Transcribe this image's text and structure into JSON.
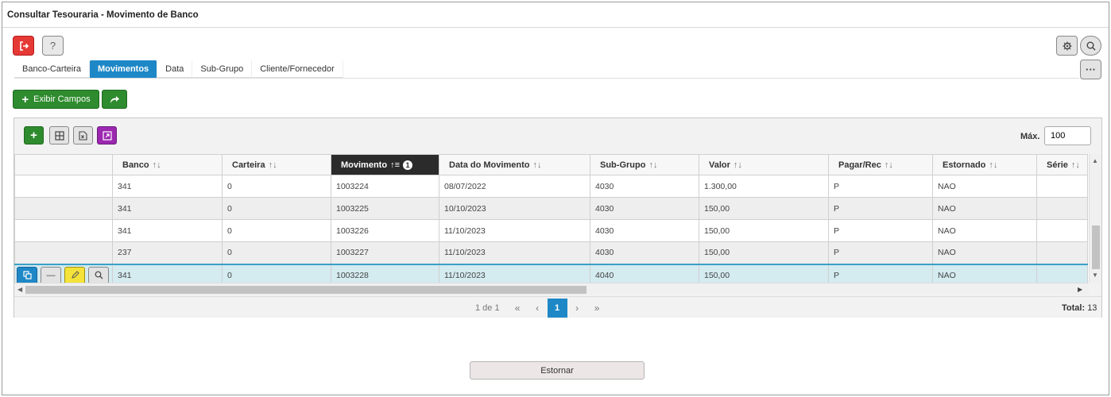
{
  "window": {
    "title": "Consultar Tesouraria - Movimento de Banco"
  },
  "toolbar": {
    "exit_icon": "exit-icon",
    "help_label": "?",
    "gear_icon": "gear-icon",
    "search_icon": "search-icon",
    "more_label": "···"
  },
  "tabs": [
    {
      "label": "Banco-Carteira",
      "active": false
    },
    {
      "label": "Movimentos",
      "active": true
    },
    {
      "label": "Data",
      "active": false
    },
    {
      "label": "Sub-Grupo",
      "active": false
    },
    {
      "label": "Cliente/Fornecedor",
      "active": false
    }
  ],
  "actions": {
    "show_fields_label": "Exibir Campos",
    "share_icon": "share-arrow-icon"
  },
  "grid": {
    "max_label": "Máx.",
    "max_value": "100",
    "columns": [
      "Banco",
      "Carteira",
      "Movimento",
      "Data do Movimento",
      "Sub-Grupo",
      "Valor",
      "Pagar/Rec",
      "Estornado",
      "Série"
    ],
    "sorted_column_badge": "1",
    "rows": [
      [
        "341",
        "0",
        "1003224",
        "08/07/2022",
        "4030",
        "1.300,00",
        "P",
        "NAO",
        ""
      ],
      [
        "341",
        "0",
        "1003225",
        "10/10/2023",
        "4030",
        "150,00",
        "P",
        "NAO",
        ""
      ],
      [
        "341",
        "0",
        "1003226",
        "11/10/2023",
        "4030",
        "150,00",
        "P",
        "NAO",
        ""
      ],
      [
        "237",
        "0",
        "1003227",
        "11/10/2023",
        "4030",
        "150,00",
        "P",
        "NAO",
        ""
      ],
      [
        "341",
        "0",
        "1003228",
        "11/10/2023",
        "4040",
        "150,00",
        "P",
        "NAO",
        ""
      ]
    ],
    "selected_row": 4,
    "pager": {
      "info": "1 de 1",
      "current": "1"
    },
    "total_label": "Total:",
    "total_value": "13"
  },
  "bottom": {
    "estornar_label": "Estornar"
  },
  "colors": {
    "accent": "#1e88c7",
    "green": "#2e8b2e",
    "red": "#e53935",
    "purple": "#9c27b0",
    "yellow": "#f5e33a"
  }
}
